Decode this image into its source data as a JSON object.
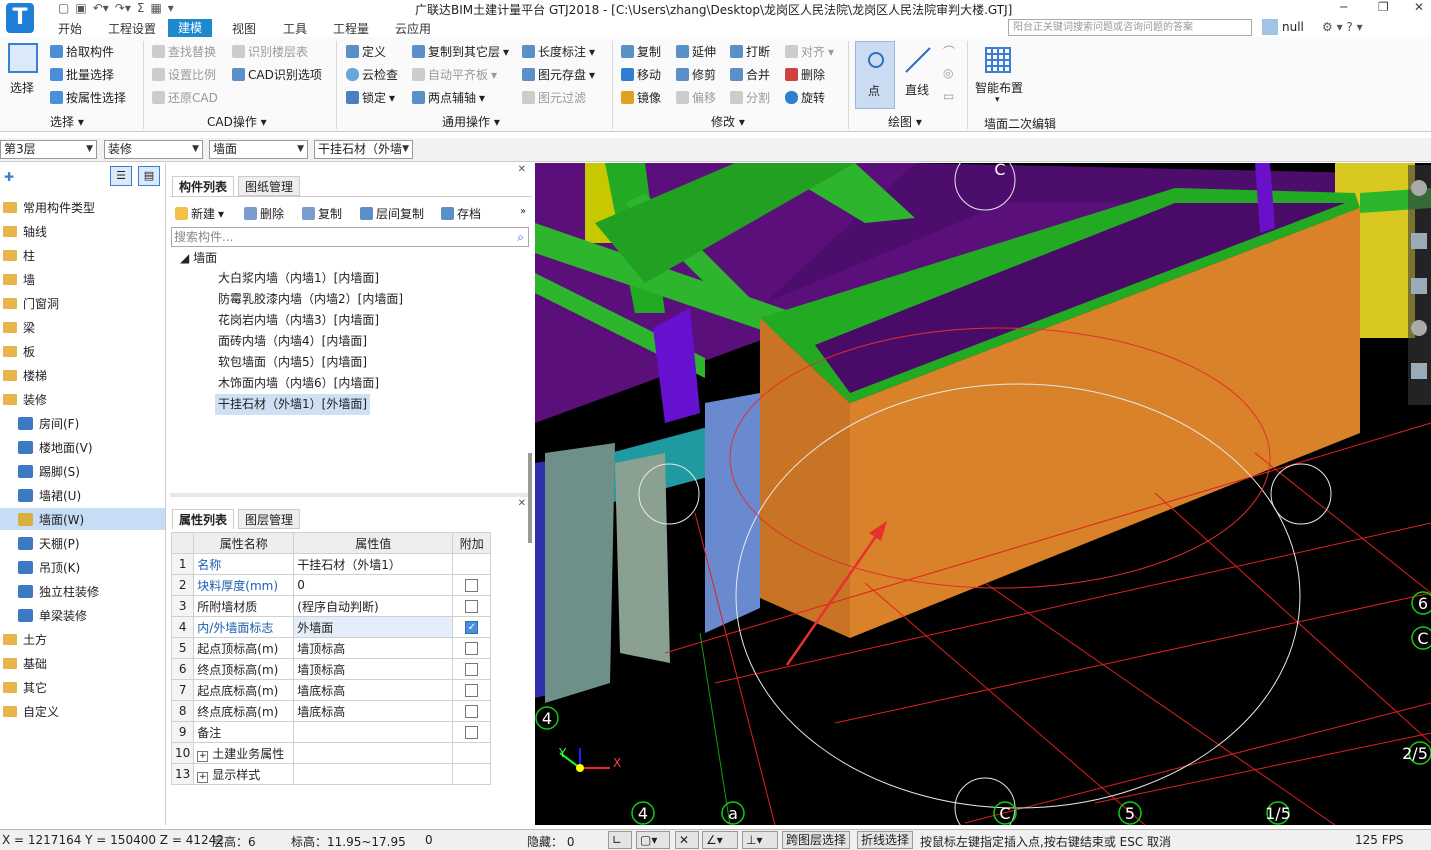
{
  "app": {
    "logo": "T",
    "title": "广联达BIM土建计量平台 GTJ2018 - [C:\\Users\\zhang\\Desktop\\龙岗区人民法院\\龙岗区人民法院审判大楼.GTJ]",
    "help_search_placeholder": "阳台正关键词搜索问题或咨询问题的答案",
    "user": "null"
  },
  "menu_tabs": [
    "开始",
    "工程设置",
    "建模",
    "视图",
    "工具",
    "工程量",
    "云应用"
  ],
  "ribbon": {
    "select": {
      "big_button": "选择",
      "items": [
        "拾取构件",
        "批量选择",
        "按属性选择"
      ],
      "group": "选择"
    },
    "cad": {
      "items": [
        "查找替换",
        "设置比例",
        "还原CAD",
        "识别楼层表",
        "CAD识别选项"
      ],
      "group": "CAD操作"
    },
    "general": {
      "items": [
        "定义",
        "云检查",
        "锁定",
        "复制到其它层",
        "自动平齐板",
        "两点辅轴",
        "长度标注",
        "图元存盘",
        "图元过滤"
      ],
      "group": "通用操作"
    },
    "modify": {
      "items": [
        "复制",
        "移动",
        "镜像",
        "延伸",
        "修剪",
        "偏移",
        "打断",
        "合并",
        "分割",
        "对齐",
        "删除",
        "旋转"
      ],
      "group": "修改"
    },
    "draw": {
      "items": [
        "点",
        "直线"
      ],
      "group": "绘图"
    },
    "wall_edit": {
      "items": [
        "智能布置"
      ],
      "group": "墙面二次编辑"
    }
  },
  "selectors": {
    "floor": "第3层",
    "category": "装修",
    "type": "墙面",
    "component": "干挂石材（外墙"
  },
  "tree": {
    "items": [
      "常用构件类型",
      "轴线",
      "柱",
      "墙",
      "门窗洞",
      "梁",
      "板",
      "楼梯",
      "装修"
    ],
    "sub_items": [
      "房间(F)",
      "楼地面(V)",
      "踢脚(S)",
      "墙裙(U)",
      "墙面(W)",
      "天棚(P)",
      "吊顶(K)",
      "独立柱装修",
      "单梁装修"
    ],
    "after_items": [
      "土方",
      "基础",
      "其它",
      "自定义"
    ]
  },
  "component_panel": {
    "tabs": [
      "构件列表",
      "图纸管理"
    ],
    "toolbar": [
      "新建",
      "删除",
      "复制",
      "层间复制",
      "存档"
    ],
    "search_placeholder": "搜索构件...",
    "root": "墙面",
    "items": [
      "大白浆内墙（内墙1）[内墙面]",
      "防霉乳胶漆内墙（内墙2）[内墙面]",
      "花岗岩内墙（内墙3）[内墙面]",
      "面砖内墙（内墙4）[内墙面]",
      "软包墙面（内墙5）[内墙面]",
      "木饰面内墙（内墙6）[内墙面]",
      "干挂石材（外墙1）[外墙面]"
    ]
  },
  "property_panel": {
    "tabs": [
      "属性列表",
      "图层管理"
    ],
    "headers": [
      "属性名称",
      "属性值",
      "附加"
    ],
    "rows": [
      {
        "no": "1",
        "name": "名称",
        "value": "干挂石材（外墙1）",
        "checked": null
      },
      {
        "no": "2",
        "name": "块料厚度(mm)",
        "value": "0",
        "checked": false
      },
      {
        "no": "3",
        "name": "所附墙材质",
        "value": "(程序自动判断)",
        "checked": false
      },
      {
        "no": "4",
        "name": "内/外墙面标志",
        "value": "外墙面",
        "checked": true
      },
      {
        "no": "5",
        "name": "起点顶标高(m)",
        "value": "墙顶标高",
        "checked": false
      },
      {
        "no": "6",
        "name": "终点顶标高(m)",
        "value": "墙顶标高",
        "checked": false
      },
      {
        "no": "7",
        "name": "起点底标高(m)",
        "value": "墙底标高",
        "checked": false
      },
      {
        "no": "8",
        "name": "终点底标高(m)",
        "value": "墙底标高",
        "checked": false
      },
      {
        "no": "9",
        "name": "备注",
        "value": "",
        "checked": false
      },
      {
        "no": "10",
        "name": "土建业务属性",
        "value": "",
        "checked": null
      },
      {
        "no": "13",
        "name": "显示样式",
        "value": "",
        "checked": null
      }
    ]
  },
  "viewport": {
    "axis_labels": [
      "4",
      "a",
      "C",
      "5",
      "1/5",
      "6",
      "C",
      "2/5",
      "4",
      "C"
    ]
  },
  "status": {
    "coords": "X = 1217164 Y = 150400 Z = 41242",
    "floor_height": "层高：6",
    "elevation": "标高：11.95~17.95",
    "count": "0",
    "hidden": "隐藏： 0",
    "cross_layer": "跨图层选择",
    "polyline": "折线选择",
    "hint": "按鼠标左键指定插入点,按右键结束或 ESC 取消",
    "fps": "125 FPS"
  }
}
